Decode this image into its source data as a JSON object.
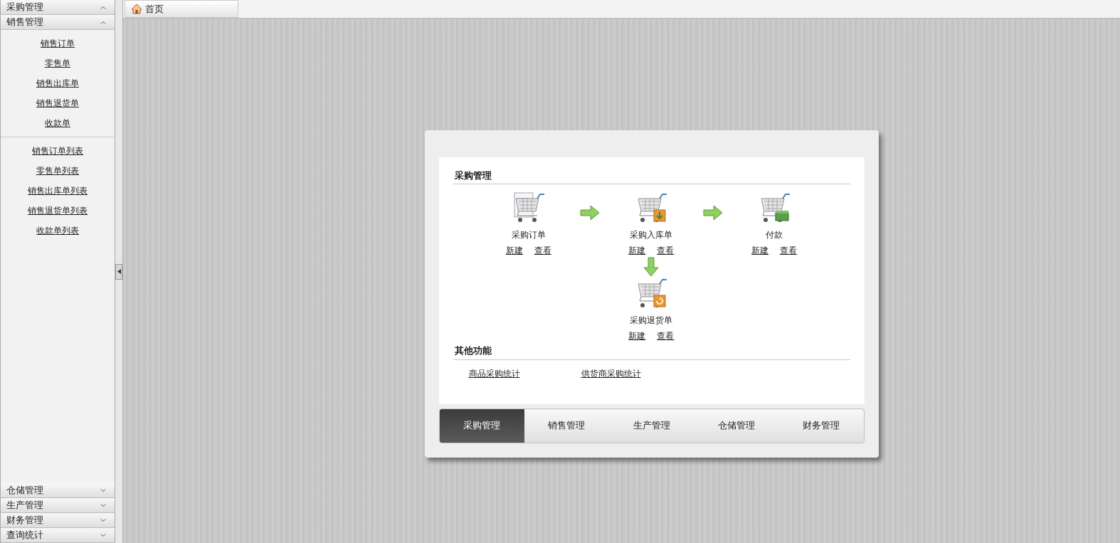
{
  "sidebar": {
    "sections": [
      {
        "title": "采购管理",
        "caret_up": true
      },
      {
        "title": "销售管理",
        "caret_up": true,
        "groups": [
          [
            "销售订单",
            "零售单",
            "销售出库单",
            "销售退货单",
            "收款单"
          ],
          [
            "销售订单列表",
            "零售单列表",
            "销售出库单列表",
            "销售退货单列表",
            "收款单列表"
          ]
        ]
      },
      {
        "title": "仓储管理",
        "caret_up": false
      },
      {
        "title": "生产管理",
        "caret_up": false
      },
      {
        "title": "财务管理",
        "caret_up": false
      },
      {
        "title": "查询统计",
        "caret_up": false
      }
    ]
  },
  "tabs": [
    {
      "label": "首页",
      "selected": true
    }
  ],
  "panel": {
    "flow_title": "采购管理",
    "nodes": [
      {
        "kind": "order",
        "label": "采购订单",
        "links": [
          "新建",
          "查看"
        ]
      },
      {
        "kind": "inbound",
        "label": "采购入库单",
        "links": [
          "新建",
          "查看"
        ]
      },
      {
        "kind": "payment",
        "label": "付款",
        "links": [
          "新建",
          "查看"
        ]
      },
      {
        "kind": "return",
        "label": "采购退货单",
        "links": [
          "新建",
          "查看"
        ]
      }
    ],
    "other_title": "其他功能",
    "other_links": [
      "商品采购统计",
      "供货商采购统计"
    ],
    "module_tabs": [
      {
        "label": "采购管理",
        "selected": true
      },
      {
        "label": "销售管理",
        "selected": false
      },
      {
        "label": "生产管理",
        "selected": false
      },
      {
        "label": "仓储管理",
        "selected": false
      },
      {
        "label": "财务管理",
        "selected": false
      }
    ]
  }
}
